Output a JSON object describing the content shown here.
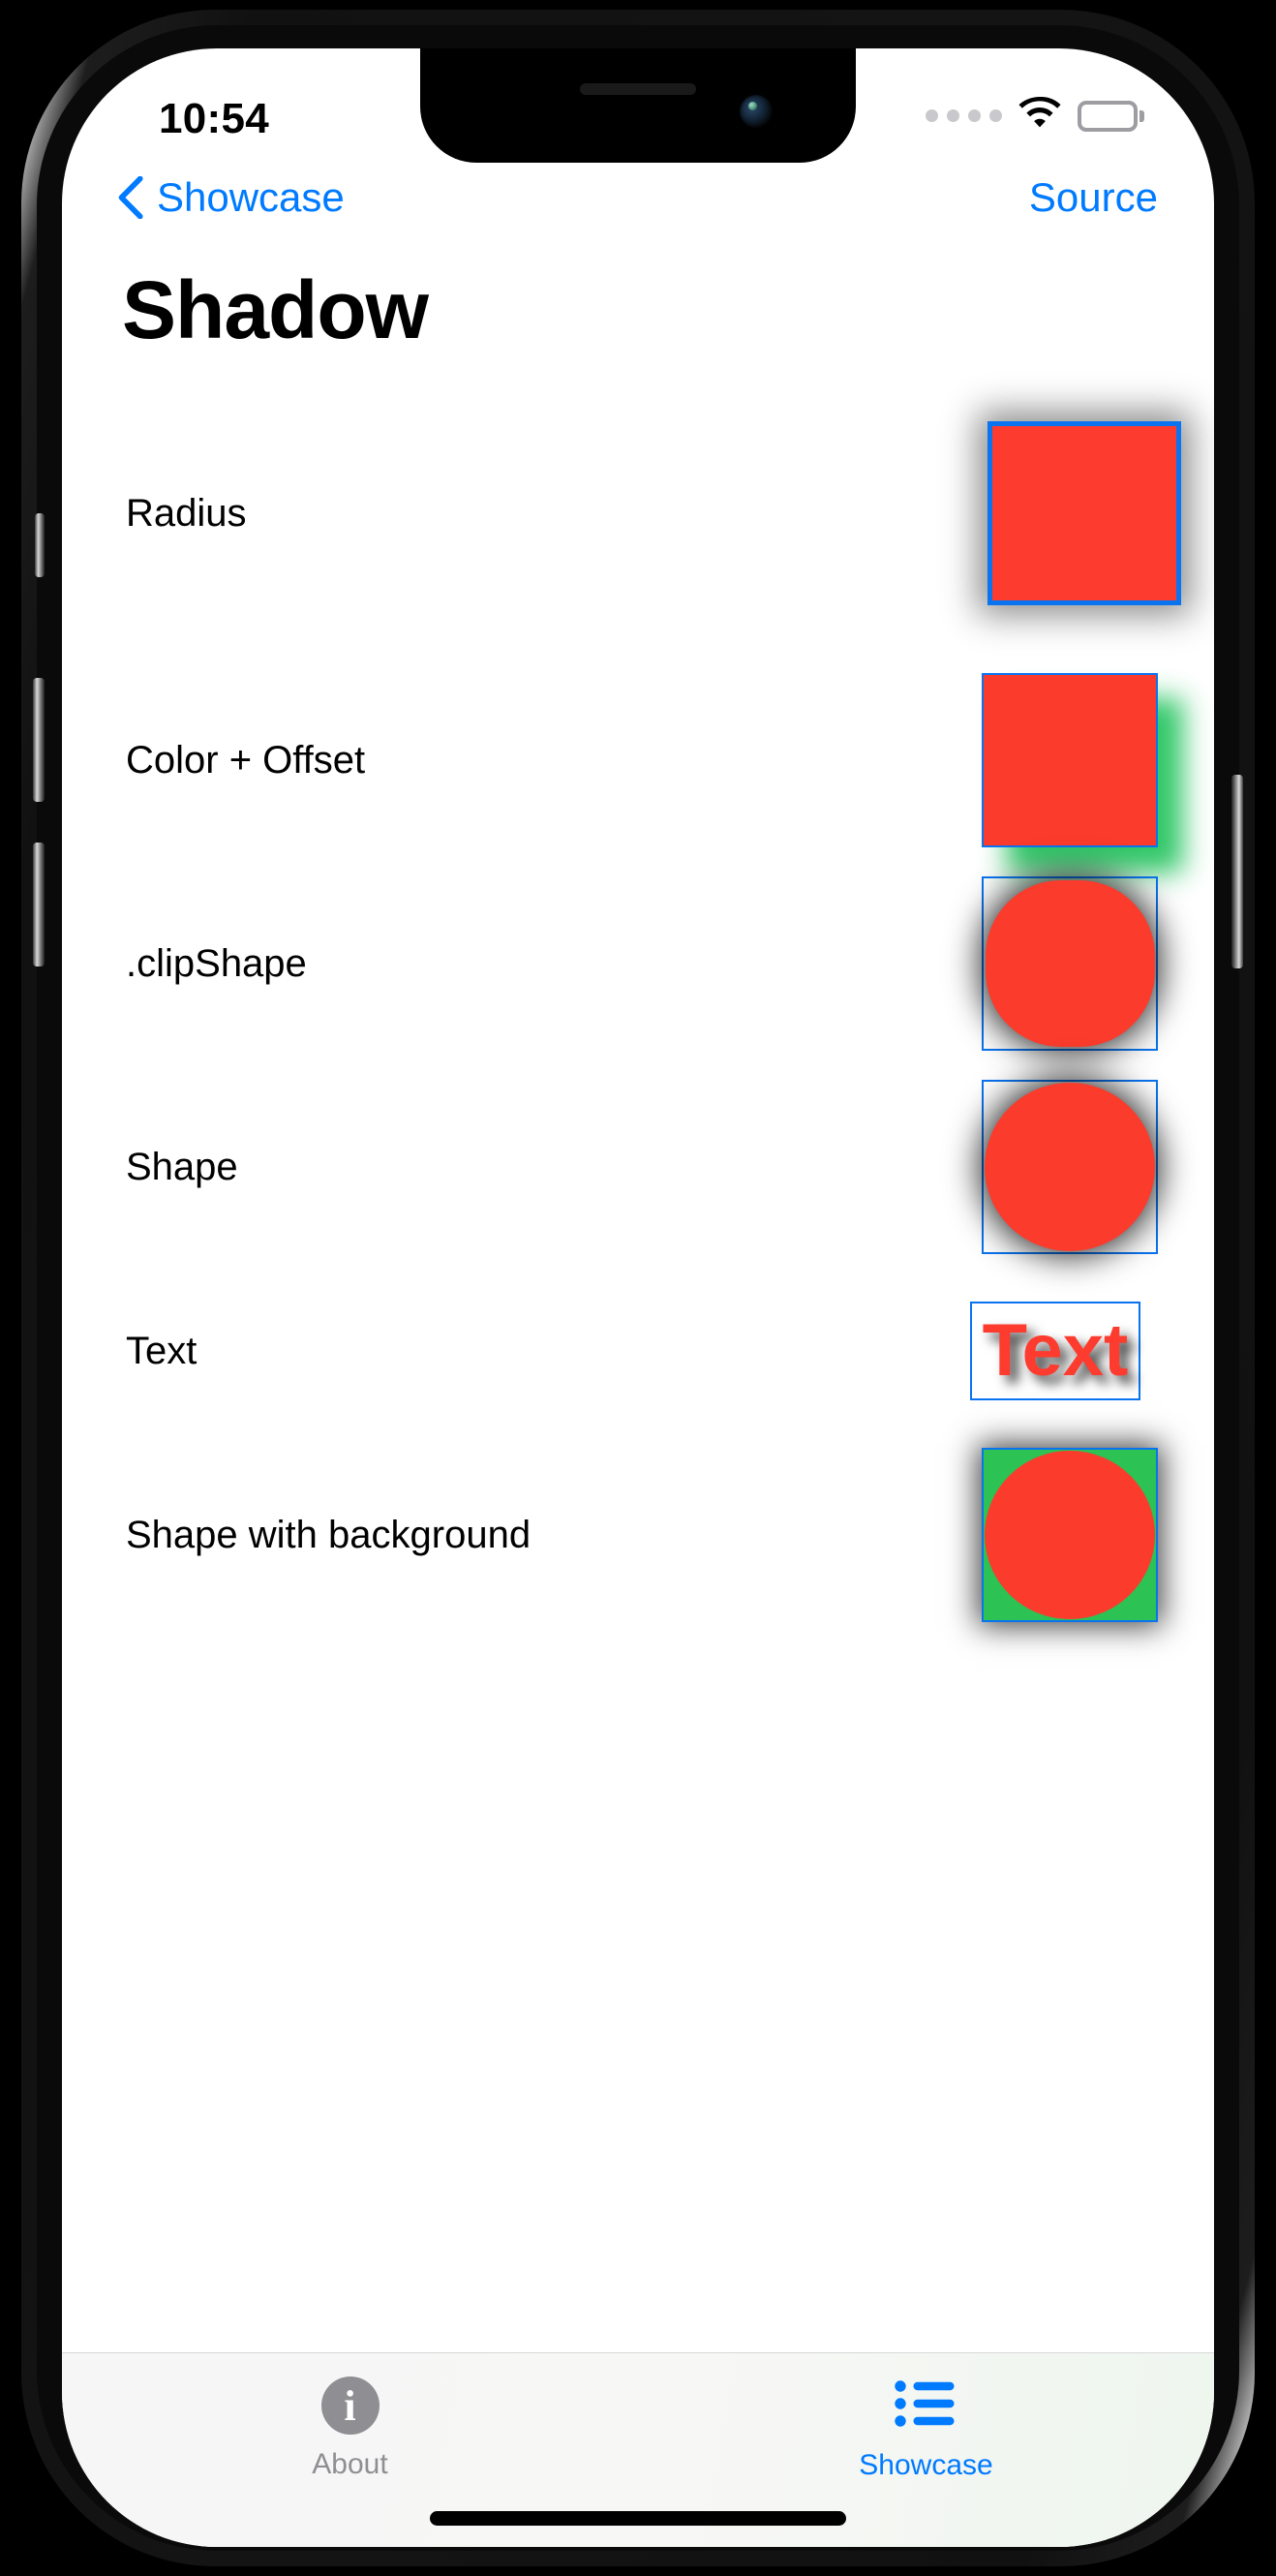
{
  "status_bar": {
    "time": "10:54",
    "signal_dots": 4,
    "wifi": "wifi-icon",
    "battery": "battery-full-icon"
  },
  "nav_bar": {
    "back_label": "Showcase",
    "back_icon": "chevron-left-icon",
    "right_action": "Source",
    "tint_color": "#007aff"
  },
  "page_title": "Shadow",
  "rows": [
    {
      "label": "Radius",
      "demo": "red-square-blur-shadow"
    },
    {
      "label": "Color + Offset",
      "demo": "red-square-green-offset-shadow"
    },
    {
      "label": ".clipShape",
      "demo": "red-rounded-square-shadow"
    },
    {
      "label": "Shape",
      "demo": "red-circle-shadow"
    },
    {
      "label": "Text",
      "demo": "text-shadow",
      "demo_text": "Text"
    },
    {
      "label": "Shape with background",
      "demo": "red-circle-green-background-shadow"
    }
  ],
  "tab_bar": {
    "tabs": [
      {
        "label": "About",
        "icon": "info-circle-icon",
        "active": false
      },
      {
        "label": "Showcase",
        "icon": "list-bullet-icon",
        "active": true
      }
    ]
  },
  "colors": {
    "accent": "#007aff",
    "shape_red": "#fd3b2e",
    "shadow_green": "#26c460",
    "background_green": "#2cc254",
    "outline_blue": "#0a74f0",
    "inactive_gray": "#8e8e93"
  }
}
